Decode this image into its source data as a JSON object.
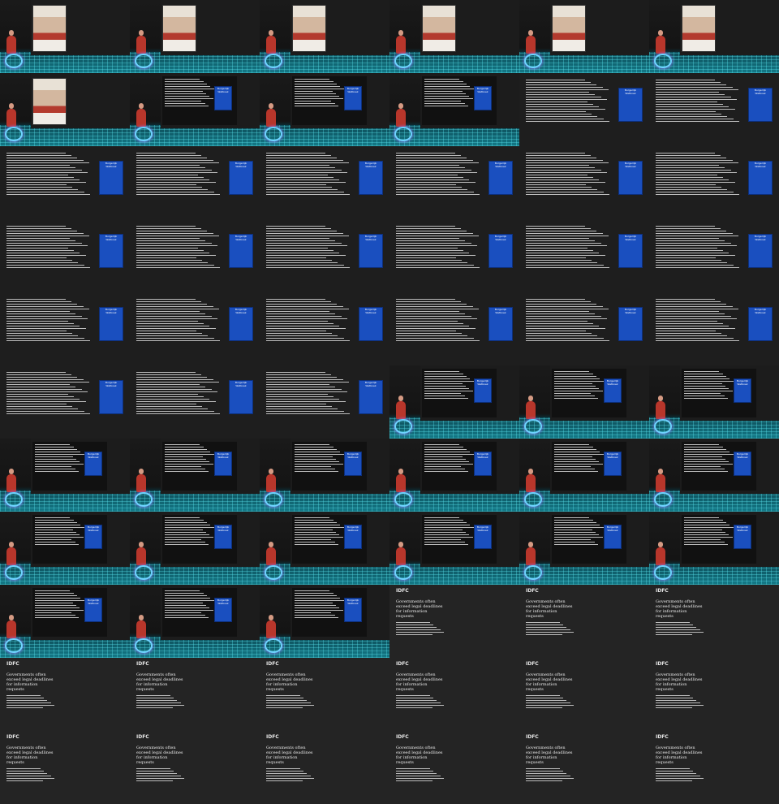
{
  "tiles": [
    {
      "kind": "stage-poster"
    },
    {
      "kind": "stage-poster"
    },
    {
      "kind": "stage-poster"
    },
    {
      "kind": "stage-poster"
    },
    {
      "kind": "stage-poster"
    },
    {
      "kind": "stage-poster"
    },
    {
      "kind": "stage-poster"
    },
    {
      "kind": "stage-doc"
    },
    {
      "kind": "stage-doc"
    },
    {
      "kind": "stage-doc"
    },
    {
      "kind": "slide"
    },
    {
      "kind": "slide"
    },
    {
      "kind": "slide"
    },
    {
      "kind": "slide"
    },
    {
      "kind": "slide"
    },
    {
      "kind": "slide"
    },
    {
      "kind": "slide"
    },
    {
      "kind": "slide"
    },
    {
      "kind": "slide"
    },
    {
      "kind": "slide"
    },
    {
      "kind": "slide"
    },
    {
      "kind": "slide"
    },
    {
      "kind": "slide"
    },
    {
      "kind": "slide"
    },
    {
      "kind": "slide"
    },
    {
      "kind": "slide"
    },
    {
      "kind": "slide"
    },
    {
      "kind": "slide"
    },
    {
      "kind": "slide"
    },
    {
      "kind": "slide"
    },
    {
      "kind": "slide"
    },
    {
      "kind": "slide"
    },
    {
      "kind": "slide"
    },
    {
      "kind": "stage-doc"
    },
    {
      "kind": "stage-doc"
    },
    {
      "kind": "stage-doc"
    },
    {
      "kind": "stage-doc"
    },
    {
      "kind": "stage-doc"
    },
    {
      "kind": "stage-doc"
    },
    {
      "kind": "stage-doc"
    },
    {
      "kind": "stage-doc"
    },
    {
      "kind": "stage-doc"
    },
    {
      "kind": "stage-doc"
    },
    {
      "kind": "stage-doc"
    },
    {
      "kind": "stage-doc"
    },
    {
      "kind": "stage-doc"
    },
    {
      "kind": "stage-doc"
    },
    {
      "kind": "stage-doc"
    },
    {
      "kind": "stage-doc"
    },
    {
      "kind": "stage-doc"
    },
    {
      "kind": "stage-doc"
    },
    {
      "kind": "article"
    },
    {
      "kind": "article"
    },
    {
      "kind": "article"
    },
    {
      "kind": "article"
    },
    {
      "kind": "article"
    },
    {
      "kind": "article"
    },
    {
      "kind": "article"
    },
    {
      "kind": "article"
    },
    {
      "kind": "article"
    },
    {
      "kind": "article"
    },
    {
      "kind": "article"
    },
    {
      "kind": "article"
    },
    {
      "kind": "article"
    },
    {
      "kind": "article"
    },
    {
      "kind": "article"
    }
  ],
  "book_title": "Burgerlijk Wetboek",
  "article_logo": "IDFC",
  "article_headline": "Governments often exceed legal deadlines for information requests"
}
